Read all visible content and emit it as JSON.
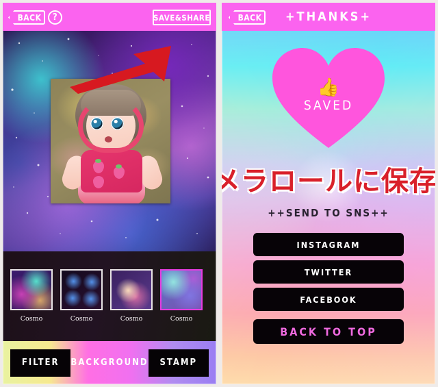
{
  "editor": {
    "header": {
      "back_label": "BACK",
      "help_label": "?",
      "save_share_label": "SAVE&SHARE"
    },
    "annotation": {
      "arrow_color": "#d71920"
    },
    "canvas": {
      "background_name": "Cosmo",
      "photo_alt": "doll-photo"
    },
    "backgrounds": [
      {
        "label": "Cosmo",
        "selected": false
      },
      {
        "label": "Cosmo",
        "selected": false
      },
      {
        "label": "Cosmo",
        "selected": false
      },
      {
        "label": "Cosmo",
        "selected": true
      }
    ],
    "tabs": [
      {
        "label": "FILTER",
        "active": false
      },
      {
        "label": "BACKGROUND",
        "active": true
      },
      {
        "label": "STAMP",
        "active": false
      }
    ],
    "colors": {
      "header_pink": "#FB63EF",
      "selected_border": "#E63CE0"
    }
  },
  "thanks": {
    "header": {
      "back_label": "BACK",
      "title": "+THANKS+"
    },
    "heart": {
      "icon": "thumbs-up-icon",
      "glyph": "👍",
      "label": "SAVED",
      "color": "#FF55DD"
    },
    "overlay_text": "カメラロールに保存",
    "sns_title": "++SEND TO SNS++",
    "buttons": [
      {
        "label": "INSTAGRAM",
        "accent": false
      },
      {
        "label": "TWITTER",
        "accent": false
      },
      {
        "label": "FACEBOOK",
        "accent": false
      },
      {
        "label": "BACK TO TOP",
        "accent": true
      }
    ],
    "colors": {
      "accent": "#F06AE0",
      "overlay_text_color": "#D9202A"
    }
  }
}
